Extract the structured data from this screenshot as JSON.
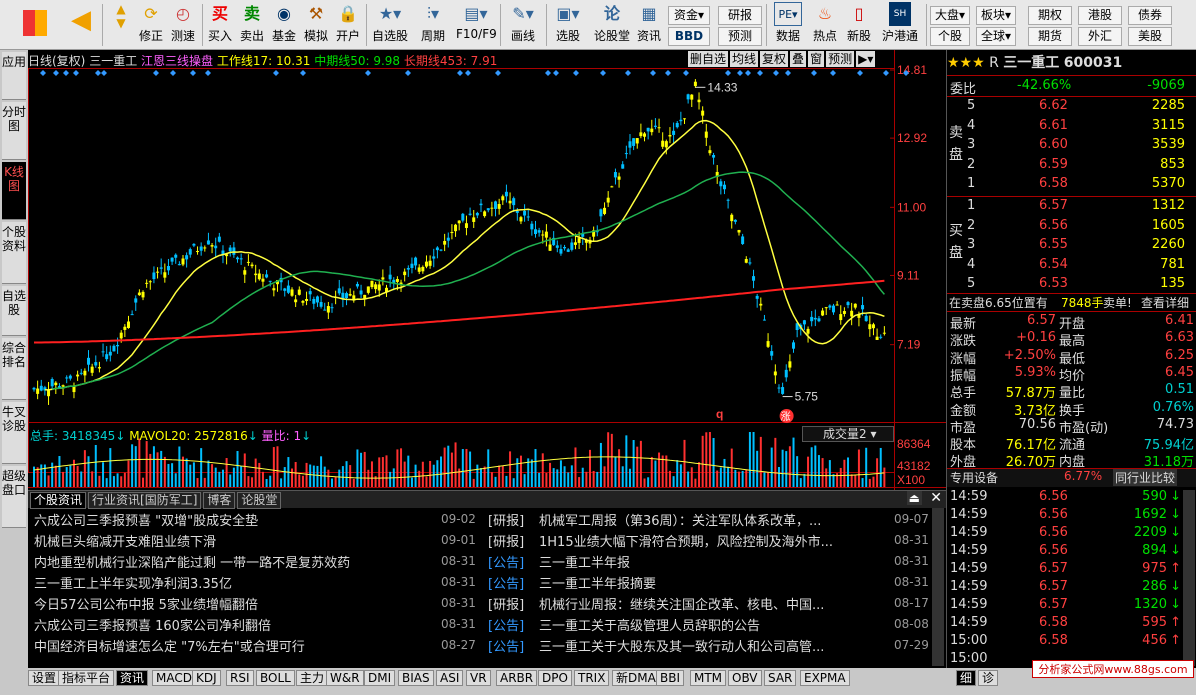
{
  "toolbar": {
    "buttons": [
      "修正",
      "测速",
      "买入",
      "卖出",
      "基金",
      "模拟",
      "开户",
      "自选股",
      "周期",
      "F10/F9",
      "画线",
      "选股",
      "论股堂",
      "资讯",
      "数据",
      "热点",
      "新股",
      "沪港通"
    ],
    "bbd": "BBD",
    "fund": "资金",
    "research": "研报",
    "predict": "预测",
    "quick": [
      "大盘",
      "板块",
      "期权",
      "港股",
      "债券",
      "个股",
      "全球",
      "期货",
      "外汇",
      "美股"
    ],
    "period_label": "周期",
    "line_label": "画线"
  },
  "vtabs": [
    "应用",
    "分时图",
    "K线图",
    "个股资料",
    "自选股",
    "综合排名",
    "牛叉诊股",
    "超级盘口"
  ],
  "chart": {
    "info_prefix": "日线(复权)",
    "stock_name": "三一重工",
    "indicator": "江恩三线操盘",
    "work_line": "工作线17: 10.31",
    "mid_line": "中期线50: 9.98",
    "long_line": "长期线453: 7.91",
    "tools": [
      "删自选",
      "均线",
      "复权",
      "叠",
      "窗",
      "预测"
    ],
    "y_ticks": [
      "14.81",
      "12.92",
      "11.00",
      "9.11",
      "7.19"
    ],
    "high_label": "14.33",
    "low_label": "5.75",
    "q_label": "q",
    "zhang_label": "涨",
    "vol_info": "总手: 3418345",
    "mavol": "MAVOL20: 2572816",
    "vol_ratio": "量比: 1",
    "vol_dropdown": "成交量2",
    "vol_ticks": [
      "86364",
      "43182",
      "X100"
    ]
  },
  "chart_data": {
    "type": "candlestick",
    "title": "日线(复权)",
    "ylim": [
      5.1,
      14.81
    ],
    "price_ticks": [
      14.81,
      12.92,
      11.0,
      9.11,
      7.19
    ],
    "high": 14.33,
    "low": 5.75,
    "volume_ticks": [
      86364,
      43182
    ],
    "series": [
      {
        "name": "工作线17",
        "last": 10.31
      },
      {
        "name": "中期线50",
        "last": 9.98
      },
      {
        "name": "长期线453",
        "last": 7.91
      }
    ]
  },
  "news": {
    "tabs": [
      "个股资讯",
      "行业资讯[国防军工]",
      "博客",
      "论股堂"
    ],
    "left": [
      {
        "title": "六成公司三季报预喜 \"双增\"股成安全垫",
        "date": "09-02"
      },
      {
        "title": "机械巨头缩减开支难阻业绩下滑",
        "date": "09-01"
      },
      {
        "title": "内地重型机械行业深陷产能过剩 一带一路不是复苏效药",
        "date": "08-31"
      },
      {
        "title": "三一重工上半年实现净利润3.35亿",
        "date": "08-31"
      },
      {
        "title": "今日57公司公布中报 5家业绩增幅翻倍",
        "date": "08-31"
      },
      {
        "title": "六成公司三季报预喜 160家公司净利翻倍",
        "date": "08-31"
      },
      {
        "title": "中国经济目标增速怎么定 \"7%左右\"或合理可行",
        "date": "08-27"
      }
    ],
    "right": [
      {
        "type": "[研报]",
        "title": "机械军工周报（第36周）：关注军队体系改革，...",
        "date": "09-07"
      },
      {
        "type": "[研报]",
        "title": "1H15业绩大幅下滑符合预期，风险控制及海外市...",
        "date": "08-31"
      },
      {
        "type": "[公告]",
        "title": "三一重工半年报",
        "date": "08-31"
      },
      {
        "type": "[公告]",
        "title": "三一重工半年报摘要",
        "date": "08-31"
      },
      {
        "type": "[研报]",
        "title": "机械行业周报：继续关注国企改革、核电、中国...",
        "date": "08-17"
      },
      {
        "type": "[公告]",
        "title": "三一重工关于高级管理人员辞职的公告",
        "date": "08-08"
      },
      {
        "type": "[公告]",
        "title": "三一重工关于大股东及其一致行动人和公司高管...",
        "date": "07-29"
      }
    ]
  },
  "quote": {
    "stars": "★★★",
    "r_label": "R",
    "name": "三一重工",
    "code": "600031",
    "weibi_label": "委比",
    "weibi": "-42.66%",
    "weicha": "-9069",
    "sell_label": "卖盘",
    "buy_label": "买盘",
    "sell": [
      {
        "lvl": "5",
        "p": "6.62",
        "v": "2285"
      },
      {
        "lvl": "4",
        "p": "6.61",
        "v": "3115"
      },
      {
        "lvl": "3",
        "p": "6.60",
        "v": "3539"
      },
      {
        "lvl": "2",
        "p": "6.59",
        "v": "853"
      },
      {
        "lvl": "1",
        "p": "6.58",
        "v": "5370"
      }
    ],
    "buy": [
      {
        "lvl": "1",
        "p": "6.57",
        "v": "1312"
      },
      {
        "lvl": "2",
        "p": "6.56",
        "v": "1605"
      },
      {
        "lvl": "3",
        "p": "6.55",
        "v": "2260"
      },
      {
        "lvl": "4",
        "p": "6.54",
        "v": "781"
      },
      {
        "lvl": "5",
        "p": "6.53",
        "v": "135"
      }
    ],
    "tip1": "在卖盘6.65位置有",
    "tip2": "7848手",
    "tip3": "卖单!",
    "tip4": "查看详细",
    "stats": [
      [
        "最新",
        "6.57",
        "开盘",
        "6.41"
      ],
      [
        "涨跌",
        "+0.16",
        "最高",
        "6.63"
      ],
      [
        "涨幅",
        "+2.50%",
        "最低",
        "6.25"
      ],
      [
        "振幅",
        "5.93%",
        "均价",
        "6.45"
      ],
      [
        "总手",
        "57.87万",
        "量比",
        "0.51"
      ],
      [
        "金额",
        "3.73亿",
        "换手",
        "0.76%"
      ],
      [
        "市盈",
        "70.56",
        "市盈(动)",
        "74.73"
      ],
      [
        "股本",
        "76.17亿",
        "流通",
        "75.94亿"
      ],
      [
        "外盘",
        "26.70万",
        "内盘",
        "31.18万"
      ]
    ],
    "tab1": "专用设备",
    "tab1_val": "6.77%",
    "tab2": "同行业比较",
    "ticks": [
      {
        "t": "14:59",
        "p": "6.56",
        "v": "590",
        "d": "down"
      },
      {
        "t": "14:59",
        "p": "6.56",
        "v": "1692",
        "d": "down"
      },
      {
        "t": "14:59",
        "p": "6.56",
        "v": "2209",
        "d": "down"
      },
      {
        "t": "14:59",
        "p": "6.56",
        "v": "894",
        "d": "down"
      },
      {
        "t": "14:59",
        "p": "6.57",
        "v": "975",
        "d": "up"
      },
      {
        "t": "14:59",
        "p": "6.57",
        "v": "286",
        "d": "down"
      },
      {
        "t": "14:59",
        "p": "6.57",
        "v": "1320",
        "d": "down"
      },
      {
        "t": "14:59",
        "p": "6.58",
        "v": "595",
        "d": "up"
      },
      {
        "t": "15:00",
        "p": "6.58",
        "v": "456",
        "d": "up"
      },
      {
        "t": "15:00",
        "p": "",
        "v": "",
        "d": ""
      }
    ]
  },
  "bottom": {
    "tabs": [
      "设置",
      "指标平台",
      "资讯",
      "MACD",
      "KDJ",
      "RSI",
      "BOLL",
      "主力",
      "W&R",
      "DMI",
      "BIAS",
      "ASI",
      "VR",
      "ARBR",
      "DPO",
      "TRIX",
      "新DMA",
      "BBI",
      "MTM",
      "OBV",
      "SAR",
      "EXPMA"
    ],
    "right_tabs": [
      "细",
      "诊"
    ],
    "watermark": "分析家公式网www.88gs.com"
  }
}
